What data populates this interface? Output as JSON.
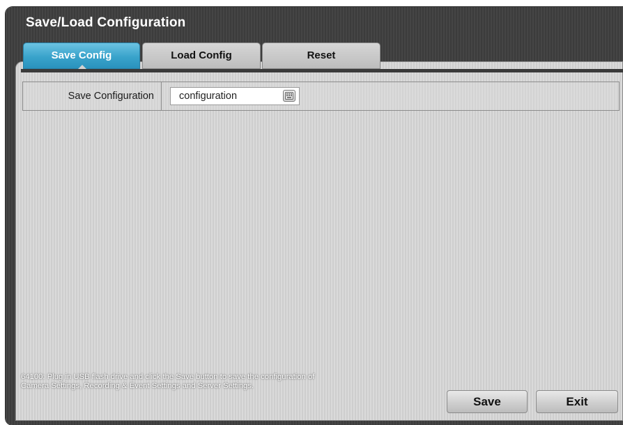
{
  "window": {
    "title": "Save/Load Configuration"
  },
  "tabs": [
    {
      "label": "Save Config",
      "active": true
    },
    {
      "label": "Load Config",
      "active": false
    },
    {
      "label": "Reset",
      "active": false
    }
  ],
  "form": {
    "save_configuration_label": "Save Configuration",
    "save_configuration_value": "configuration",
    "keyboard_icon": "keyboard-icon"
  },
  "help_text": "64100: Plug in USB flash drive and click the Save button to save the configuration of Camera Settings, Recording & Event Settings and Server Settings.",
  "buttons": {
    "save_label": "Save",
    "exit_label": "Exit"
  },
  "colors": {
    "active_tab": "#39a3cb",
    "window_bg": "#404040",
    "panel_bg": "#d4d4d4"
  }
}
